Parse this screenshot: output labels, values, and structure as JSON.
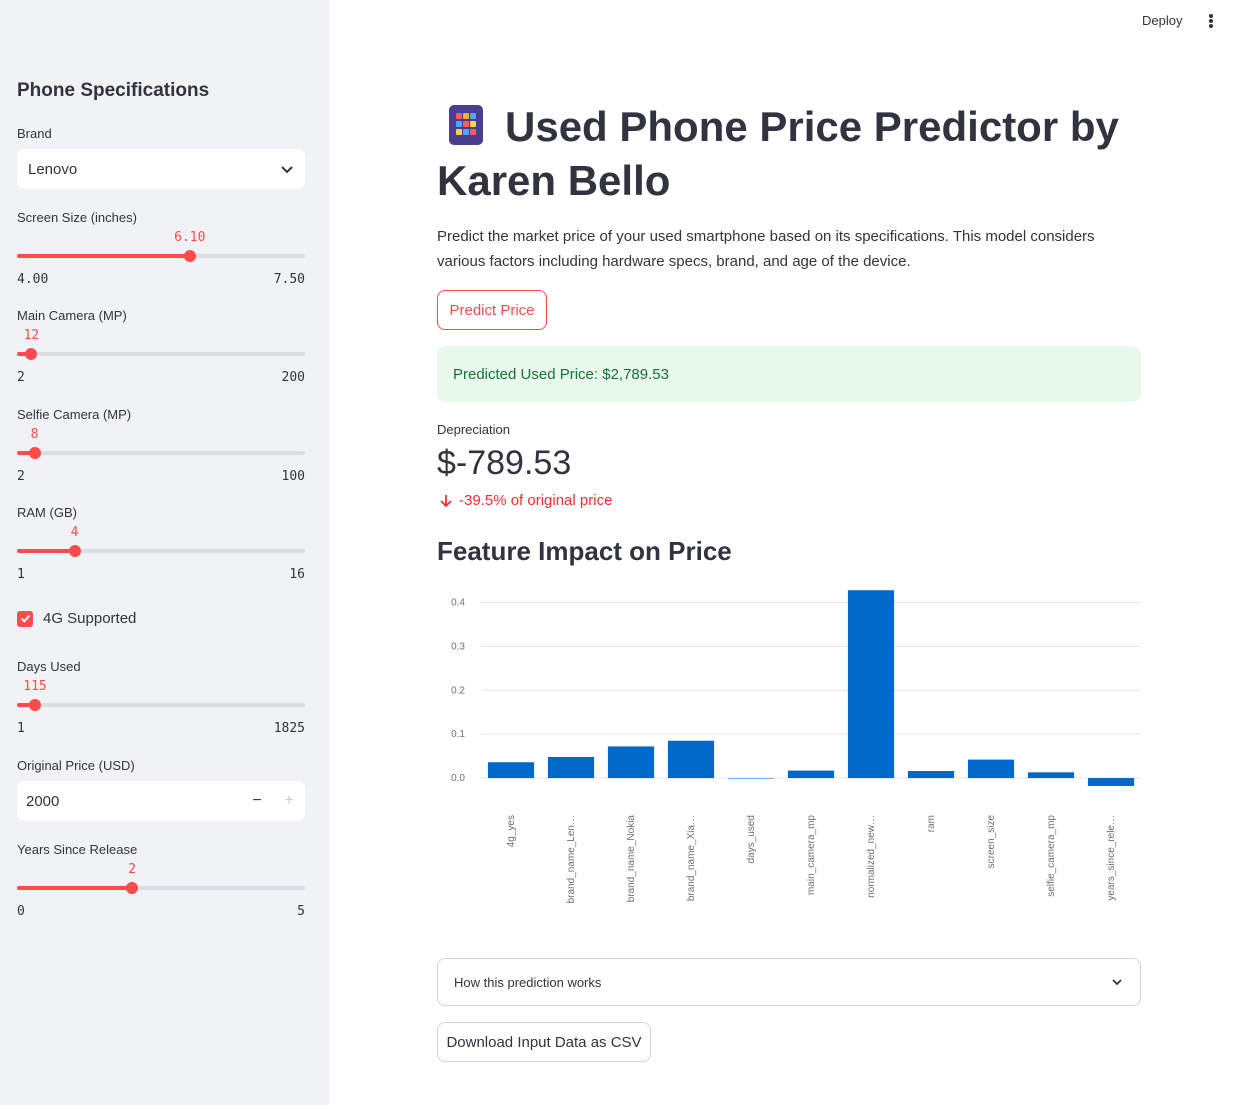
{
  "header": {
    "deploy_label": "Deploy",
    "menu_icon": "kebab-menu-icon"
  },
  "sidebar": {
    "title": "Phone Specifications",
    "brand": {
      "label": "Brand",
      "value": "Lenovo"
    },
    "screen_size": {
      "label": "Screen Size (inches)",
      "value": "6.10",
      "min": "4.00",
      "max": "7.50",
      "fraction": 0.6
    },
    "main_camera": {
      "label": "Main Camera (MP)",
      "value": "12",
      "min": "2",
      "max": "200",
      "fraction": 0.05
    },
    "selfie_camera": {
      "label": "Selfie Camera (MP)",
      "value": "8",
      "min": "2",
      "max": "100",
      "fraction": 0.061
    },
    "ram": {
      "label": "RAM (GB)",
      "value": "4",
      "min": "1",
      "max": "16",
      "fraction": 0.2
    },
    "four_g": {
      "label": "4G Supported",
      "checked": true
    },
    "days_used": {
      "label": "Days Used",
      "value": "115",
      "min": "1",
      "max": "1825",
      "fraction": 0.0625
    },
    "original_price": {
      "label": "Original Price (USD)",
      "value": "2000",
      "minus": "−",
      "plus": "+"
    },
    "years_since_release": {
      "label": "Years Since Release",
      "value": "2",
      "min": "0",
      "max": "5",
      "fraction": 0.4
    }
  },
  "main": {
    "title": "Used Phone Price Predictor by Karen Bello",
    "title_icon": "mobile-phone-icon",
    "description": "Predict the market price of your used smartphone based on its specifications. This model considers various factors including hardware specs, brand, and age of the device.",
    "predict_button": "Predict Price",
    "success_message": "Predicted Used Price: $2,789.53",
    "metric": {
      "label": "Depreciation",
      "value": "$-789.53",
      "delta": "-39.5% of original price"
    },
    "chart_heading": "Feature Impact on Price",
    "expander_label": "How this prediction works",
    "download_button": "Download Input Data as CSV"
  },
  "chart_data": {
    "type": "bar",
    "categories": [
      "4g_yes",
      "brand_name_Len…",
      "brand_name_Nokia",
      "brand_name_Xia…",
      "days_used",
      "main_camera_mp",
      "normalized_new…",
      "ram",
      "screen_size",
      "selfie_camera_mp",
      "years_since_rele…"
    ],
    "values": [
      0.036,
      0.048,
      0.072,
      0.085,
      0.0,
      0.017,
      0.428,
      0.016,
      0.042,
      0.013,
      -0.018
    ],
    "yticks": [
      0.0,
      0.1,
      0.2,
      0.3,
      0.4
    ],
    "ylim": [
      -0.025,
      0.44
    ],
    "color": "#0068c9",
    "grid": true
  },
  "colors": {
    "accent": "#ff4b4b",
    "sidebar_bg": "#f0f2f6",
    "success_bg": "#e8f8ec",
    "success_text": "#177233"
  }
}
